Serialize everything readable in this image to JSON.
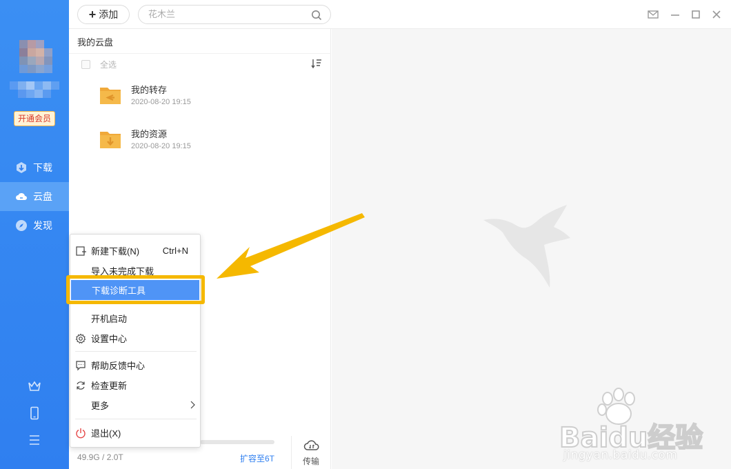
{
  "sidebar": {
    "vip_label": "开通会员",
    "nav": [
      {
        "label": "下载",
        "icon": "download-icon"
      },
      {
        "label": "云盘",
        "icon": "cloud-icon"
      },
      {
        "label": "发现",
        "icon": "compass-icon"
      }
    ],
    "bottom_icons": [
      "crown-icon",
      "phone-icon",
      "menu-icon"
    ]
  },
  "topbar": {
    "add_label": "添加",
    "search_placeholder": "花木兰",
    "window_controls": [
      "mail-icon",
      "minimize-icon",
      "maximize-icon",
      "close-icon"
    ]
  },
  "panel": {
    "breadcrumb": "我的云盘",
    "select_all": "全选",
    "files": [
      {
        "name": "我的转存",
        "date": "2020-08-20 19:15",
        "icon": "folder-transfer-icon"
      },
      {
        "name": "我的资源",
        "date": "2020-08-20 19:15",
        "icon": "folder-download-icon"
      }
    ],
    "storage_text": "49.9G / 2.0T",
    "expand_link": "扩容至6T",
    "transfer_label": "传输"
  },
  "menu": {
    "items": [
      {
        "label": "新建下载(N)",
        "shortcut": "Ctrl+N",
        "icon": "new-download-icon"
      },
      {
        "label": "导入未完成下载"
      },
      {
        "label": "下载诊断工具",
        "highlighted": true
      },
      {
        "label": "开机启动"
      },
      {
        "label": "设置中心",
        "icon": "gear-icon"
      },
      {
        "label": "帮助反馈中心",
        "icon": "feedback-icon"
      },
      {
        "label": "检查更新",
        "icon": "refresh-icon"
      },
      {
        "label": "更多",
        "icon": "chevron-right-icon"
      },
      {
        "label": "退出(X)",
        "icon": "power-icon"
      }
    ]
  },
  "watermark": {
    "brand": "Baidu经验",
    "url": "jingyan.baidu.com"
  },
  "colors": {
    "sidebar": "#2f7ff0",
    "accent": "#2f7ff0",
    "highlight_box": "#f5b800",
    "menu_highlight": "#4f94f6",
    "vip_text": "#d8382b",
    "folder": "#f5b94a"
  }
}
